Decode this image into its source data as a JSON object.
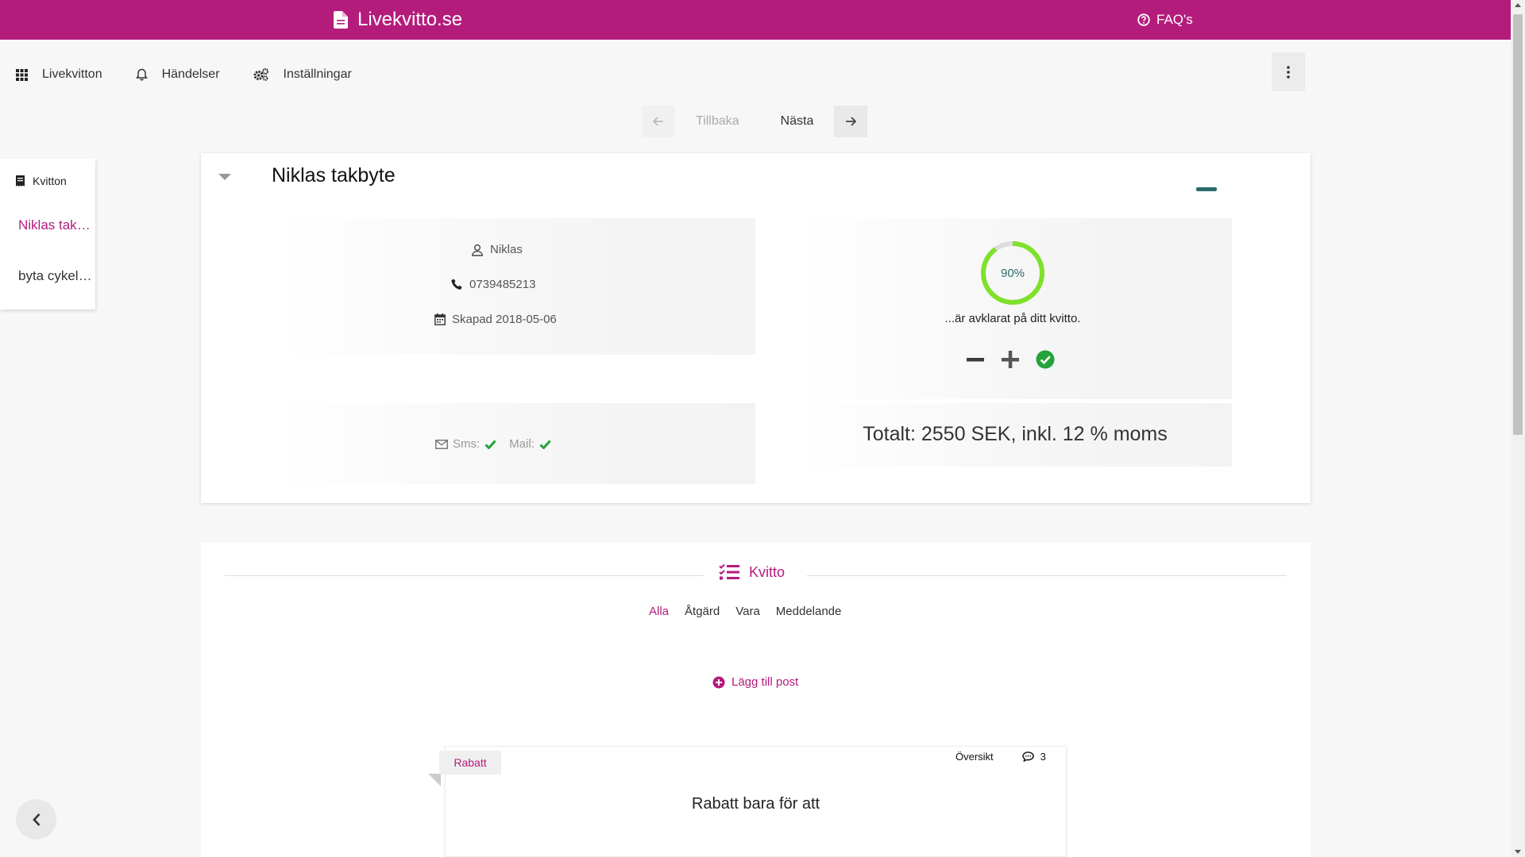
{
  "header": {
    "brand": "Livekvitto.se",
    "faq": "FAQ's",
    "accent": "#b41c7c"
  },
  "nav": {
    "items": [
      {
        "label": "Livekvitton",
        "icon": "grid-icon"
      },
      {
        "label": "Händelser",
        "icon": "bell-icon"
      },
      {
        "label": "Inställningar",
        "icon": "gears-icon"
      }
    ]
  },
  "pager": {
    "back": "Tillbaka",
    "next": "Nästa"
  },
  "sidebar": {
    "heading": "Kvitton",
    "items": [
      "Niklas takbyte",
      "byta cykeldäck"
    ]
  },
  "receipt": {
    "title": "Niklas takbyte",
    "name": "Niklas",
    "phone": "0739485213",
    "created": "Skapad 2018-05-06",
    "sms_label": "Sms:",
    "mail_label": "Mail:",
    "progress_percent": 90,
    "progress_text": "90%",
    "progress_caption": "...är avklarat på ditt kvitto.",
    "total": "Totalt: 2550 SEK, inkl. 12 % moms",
    "progress_color": "#7ee12a",
    "check_color": "#23a33a"
  },
  "section": {
    "title": "Kvitto",
    "tabs": [
      "Alla",
      "Åtgärd",
      "Vara",
      "Meddelande"
    ],
    "active_tab": "Alla",
    "add_post": "Lägg till post"
  },
  "post": {
    "tag": "Rabatt",
    "overview": "Översikt",
    "comments": "3",
    "title": "Rabatt bara för att"
  }
}
